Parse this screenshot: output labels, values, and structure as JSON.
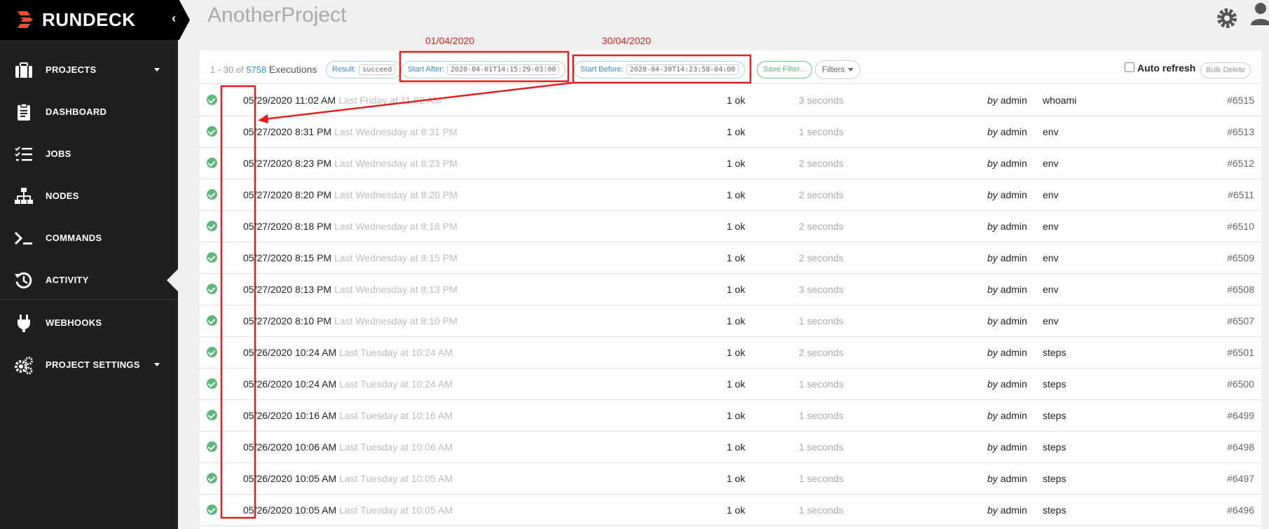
{
  "brand": {
    "name": "RUNDECK"
  },
  "sidebar": {
    "items": [
      {
        "label": "PROJECTS",
        "icon": "briefcase-icon"
      },
      {
        "label": "DASHBOARD",
        "icon": "clipboard-icon"
      },
      {
        "label": "JOBS",
        "icon": "list-check-icon"
      },
      {
        "label": "NODES",
        "icon": "sitemap-icon"
      },
      {
        "label": "COMMANDS",
        "icon": "terminal-icon"
      },
      {
        "label": "ACTIVITY",
        "icon": "history-icon"
      },
      {
        "label": "WEBHOOKS",
        "icon": "plug-icon"
      },
      {
        "label": "PROJECT SETTINGS",
        "icon": "gears-icon"
      }
    ],
    "active": "ACTIVITY"
  },
  "header": {
    "project": "AnotherProject"
  },
  "filters": {
    "range_prefix": "1 - 30 of",
    "total": "5758",
    "total_suffix": "Executions",
    "result_label": "Result:",
    "result_value": "succeed",
    "start_after_label": "Start After:",
    "start_after_value": "2020-04-01T14:15:29-03:00",
    "start_before_label": "Start Before:",
    "start_before_value": "2020-04-30T14:23:58-04:00",
    "save_filter": "Save Filter...",
    "filters_button": "Filters",
    "auto_refresh": "Auto refresh",
    "bulk_delete": "Bulk Delete"
  },
  "annotations": {
    "start_after_note": "01/04/2020",
    "start_before_note": "30/04/2020"
  },
  "executions": [
    {
      "date": "05/29/2020 11:02 AM",
      "relative": "Last Friday at 11:02 AM",
      "status": "1 ok",
      "duration": "3 seconds",
      "by": "by",
      "user": "admin",
      "job": "whoami",
      "id": "#6515"
    },
    {
      "date": "05/27/2020 8:31 PM",
      "relative": "Last Wednesday at 8:31 PM",
      "status": "1 ok",
      "duration": "1 seconds",
      "by": "by",
      "user": "admin",
      "job": "env",
      "id": "#6513"
    },
    {
      "date": "05/27/2020 8:23 PM",
      "relative": "Last Wednesday at 8:23 PM",
      "status": "1 ok",
      "duration": "2 seconds",
      "by": "by",
      "user": "admin",
      "job": "env",
      "id": "#6512"
    },
    {
      "date": "05/27/2020 8:20 PM",
      "relative": "Last Wednesday at 8:20 PM",
      "status": "1 ok",
      "duration": "2 seconds",
      "by": "by",
      "user": "admin",
      "job": "env",
      "id": "#6511"
    },
    {
      "date": "05/27/2020 8:18 PM",
      "relative": "Last Wednesday at 8:18 PM",
      "status": "1 ok",
      "duration": "2 seconds",
      "by": "by",
      "user": "admin",
      "job": "env",
      "id": "#6510"
    },
    {
      "date": "05/27/2020 8:15 PM",
      "relative": "Last Wednesday at 8:15 PM",
      "status": "1 ok",
      "duration": "2 seconds",
      "by": "by",
      "user": "admin",
      "job": "env",
      "id": "#6509"
    },
    {
      "date": "05/27/2020 8:13 PM",
      "relative": "Last Wednesday at 8:13 PM",
      "status": "1 ok",
      "duration": "3 seconds",
      "by": "by",
      "user": "admin",
      "job": "env",
      "id": "#6508"
    },
    {
      "date": "05/27/2020 8:10 PM",
      "relative": "Last Wednesday at 8:10 PM",
      "status": "1 ok",
      "duration": "1 seconds",
      "by": "by",
      "user": "admin",
      "job": "env",
      "id": "#6507"
    },
    {
      "date": "05/26/2020 10:24 AM",
      "relative": "Last Tuesday at 10:24 AM",
      "status": "1 ok",
      "duration": "2 seconds",
      "by": "by",
      "user": "admin",
      "job": "steps",
      "id": "#6501"
    },
    {
      "date": "05/26/2020 10:24 AM",
      "relative": "Last Tuesday at 10:24 AM",
      "status": "1 ok",
      "duration": "1 seconds",
      "by": "by",
      "user": "admin",
      "job": "steps",
      "id": "#6500"
    },
    {
      "date": "05/26/2020 10:16 AM",
      "relative": "Last Tuesday at 10:16 AM",
      "status": "1 ok",
      "duration": "1 seconds",
      "by": "by",
      "user": "admin",
      "job": "steps",
      "id": "#6499"
    },
    {
      "date": "05/26/2020 10:06 AM",
      "relative": "Last Tuesday at 10:06 AM",
      "status": "1 ok",
      "duration": "1 seconds",
      "by": "by",
      "user": "admin",
      "job": "steps",
      "id": "#6498"
    },
    {
      "date": "05/26/2020 10:05 AM",
      "relative": "Last Tuesday at 10:05 AM",
      "status": "1 ok",
      "duration": "1 seconds",
      "by": "by",
      "user": "admin",
      "job": "steps",
      "id": "#6497"
    },
    {
      "date": "05/26/2020 10:05 AM",
      "relative": "Last Tuesday at 10:05 AM",
      "status": "1 ok",
      "duration": "1 seconds",
      "by": "by",
      "user": "admin",
      "job": "steps",
      "id": "#6496"
    }
  ],
  "colors": {
    "success": "#5cb87a",
    "link": "#3a8fd0",
    "annotation": "#e02020"
  }
}
